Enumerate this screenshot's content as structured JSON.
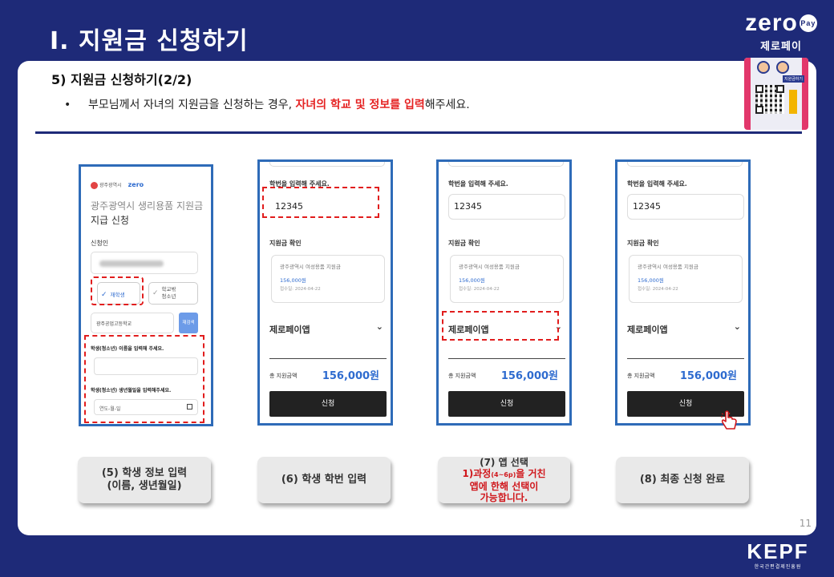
{
  "slide": {
    "title": "Ⅰ. 지원금 신청하기",
    "page_number": "11"
  },
  "brand": {
    "logo_word": "zero",
    "logo_badge": "Pay",
    "logo_sub": "제로페이",
    "qr_tag": "지원금하기"
  },
  "section": {
    "heading": "5)  지원금 신청하기(2/2)",
    "bullet_dot": "•",
    "bullet_before": "부모님께서 자녀의 지원금을 신청하는 경우, ",
    "bullet_highlight": "자녀의 학교 및 정보를 입력",
    "bullet_after": "해주세요."
  },
  "phone1": {
    "org": "광주광역시",
    "org_logo": "zero",
    "title_line1": "광주광역시 생리용품 지원금",
    "title_line2": "지급 신청",
    "applicant_label": "신청인",
    "check_student": "재학생",
    "check_outside_line1": "학교밖",
    "check_outside_line2": "청소년",
    "school_value": "광주공업고등학교",
    "research_btn": "재검색",
    "name_label": "학생(청소년) 이름을 입력해 주세요.",
    "birth_label": "학생(청소년) 생년월일을 입력해주세요.",
    "birth_placeholder": "연도-월-일"
  },
  "phone_common": {
    "student_id_label": "학번을 입력해 주세요.",
    "student_id_value": "12345",
    "confirm_label": "지원금 확인",
    "confirm_title": "광주광역시 여성용품 지원금",
    "confirm_amount": "156,000원",
    "confirm_date": "접수일: 2024-04-22",
    "app_select_value": "제로페이앱",
    "total_label": "총 지원금액",
    "total_amount": "156,000원",
    "submit_label": "신청"
  },
  "steps": {
    "s1_line1": "(5) 학생 정보 입력",
    "s1_line2": "(이름, 생년월일)",
    "s2": "(6) 학생 학번 입력",
    "s3_line1": "(7) 앱 선택",
    "s3_red1a": "1)과정",
    "s3_red1b": "(4~6p)",
    "s3_red1c": "을 거친",
    "s3_red2": "앱에 한해 선택이",
    "s3_red3": "가능합니다.",
    "s4": "(8) 최종 신청 완료"
  },
  "footer": {
    "kepf_word": "KEPF",
    "kepf_sub": "한국간편결제진흥원"
  },
  "colors": {
    "background": "#1e2a78",
    "highlight": "#e52222",
    "phone_border": "#2e6bb8",
    "amount_blue": "#2e6bcf"
  }
}
